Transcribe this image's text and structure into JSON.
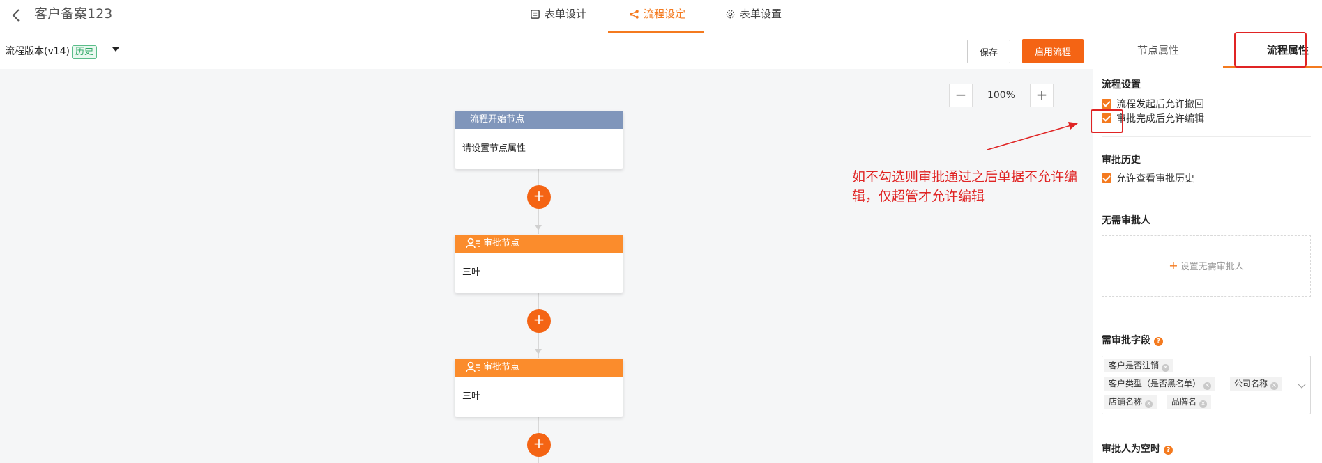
{
  "header": {
    "title": "客户备案123",
    "tabs": [
      {
        "label": "表单设计",
        "icon": "form-icon"
      },
      {
        "label": "流程设定",
        "icon": "flow-icon",
        "active": true
      },
      {
        "label": "表单设置",
        "icon": "gear-icon"
      }
    ]
  },
  "toolbar": {
    "version_label": "流程版本(v14)",
    "history_badge": "历史",
    "save_label": "保存",
    "enable_label": "启用流程"
  },
  "canvas": {
    "zoom_minus": "−",
    "zoom_level": "100%",
    "zoom_plus": "+",
    "add_symbol": "+",
    "nodes": [
      {
        "type": "start",
        "title": "流程开始节点",
        "body": "请设置节点属性"
      },
      {
        "type": "approve",
        "title": "审批节点",
        "body": "三叶"
      },
      {
        "type": "approve",
        "title": "审批节点",
        "body": "三叶"
      }
    ],
    "annotation": "如不勾选则审批通过之后单据不允许编辑，仅超管才允许编辑"
  },
  "panel": {
    "tabs": [
      {
        "label": "节点属性"
      },
      {
        "label": "流程属性",
        "active": true
      }
    ],
    "process_settings": {
      "title": "流程设置",
      "options": [
        {
          "label": "流程发起后允许撤回",
          "checked": true
        },
        {
          "label": "审批完成后允许编辑",
          "checked": true
        }
      ]
    },
    "approval_history": {
      "title": "审批历史",
      "options": [
        {
          "label": "允许查看审批历史",
          "checked": true
        }
      ]
    },
    "no_approver": {
      "title": "无需审批人",
      "button_label": "设置无需审批人"
    },
    "fields": {
      "title": "需审批字段",
      "help": "?",
      "tags": [
        "客户是否注销",
        "客户类型（是否黑名单）",
        "公司名称",
        "店铺名称",
        "品牌名"
      ]
    },
    "empty_approver": {
      "title": "审批人为空时",
      "help": "?"
    }
  },
  "colors": {
    "accent": "#f47a1f",
    "primary_button": "#f46414",
    "start_node": "#8096bb",
    "approve_node": "#fb8c2c",
    "annotation": "#e02424"
  }
}
